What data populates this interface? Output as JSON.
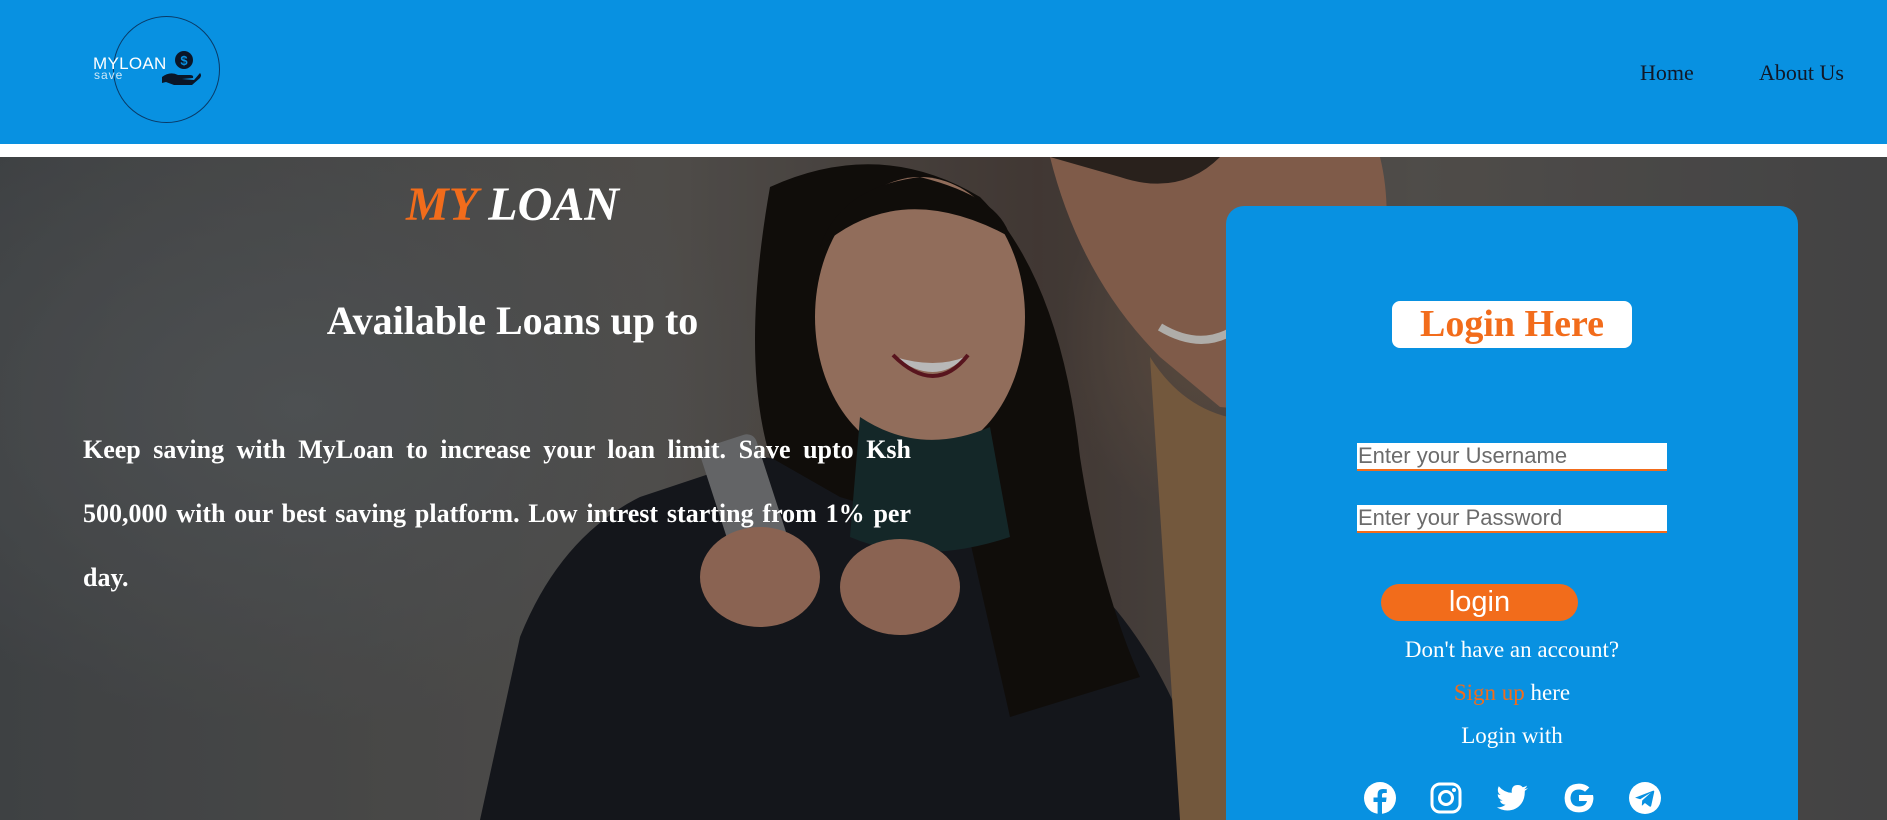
{
  "header": {
    "logo": {
      "name": "MYLOAN",
      "sub": "save",
      "icon": "hand-coin-icon"
    },
    "nav": [
      {
        "label": "Home"
      },
      {
        "label": "About Us"
      }
    ]
  },
  "hero": {
    "brand_my": "MY",
    "brand_loan": "LOAN",
    "subtitle": "Available Loans up to",
    "description": "Keep saving with MyLoan to increase your loan limit. Save upto Ksh 500,000 with our best saving platform. Low intrest starting from 1% per day."
  },
  "login": {
    "title": "Login Here",
    "username_placeholder": "Enter your Username",
    "password_placeholder": "Enter your Password",
    "button": "login",
    "no_account": "Don't have an account?",
    "signup_link": "Sign up",
    "signup_suffix": " here",
    "login_with": "Login with",
    "social": [
      "facebook-icon",
      "instagram-icon",
      "twitter-icon",
      "google-icon",
      "telegram-icon"
    ]
  },
  "colors": {
    "primary": "#0891e1",
    "accent": "#f26c1b",
    "white": "#ffffff"
  }
}
